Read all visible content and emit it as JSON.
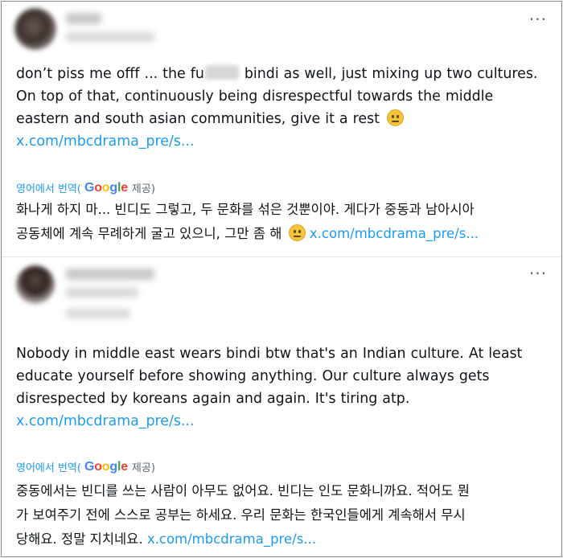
{
  "tweets": [
    {
      "text_lines": [
        "don’t piss me offf ... the fu",
        " bindi as well, just mixing up two cultures.",
        "On top of that, continuously being disrespectful towards the middle",
        "eastern and south asian communities, give it a rest"
      ],
      "link": "x.com/mbcdrama_pre/s...",
      "emoji": "neutral-face-emoji",
      "translate_label": "영어에서 번역(",
      "provided_label": "제공)",
      "google": {
        "G": "G",
        "o1": "o",
        "o2": "o",
        "g": "g",
        "l": "l",
        "e": "e"
      },
      "translated_lines": [
        "화나게 하지 마... 빈디도 그렇고, 두 문화를 섞은 것뿐이야. 게다가 중동과 남아시아",
        "공동체에 계속 무례하게 굴고 있으니, 그만 좀 해"
      ],
      "translated_link": "x.com/mbcdrama_pre/s...",
      "more_label": "···"
    },
    {
      "text_lines": [
        "Nobody in middle east wears bindi btw that's an Indian culture. At least",
        "educate yourself before showing anything. Our culture always gets",
        "disrespected by koreans again and again. It's tiring atp."
      ],
      "link": "x.com/mbcdrama_pre/s...",
      "translate_label": "영어에서 번역(",
      "provided_label": "제공)",
      "google": {
        "G": "G",
        "o1": "o",
        "o2": "o",
        "g": "g",
        "l": "l",
        "e": "e"
      },
      "translated_lines": [
        "중동에서는 빈디를 쓰는 사람이 아무도 없어요. 빈디는 인도 문화니까요. 적어도 뭔",
        "가 보여주기 전에 스스로 공부는 하세요. 우리 문화는 한국인들에게 계속해서 무시",
        "당해요. 정말 지치네요."
      ],
      "translated_link": "x.com/mbcdrama_pre/s...",
      "more_label": "···"
    }
  ]
}
